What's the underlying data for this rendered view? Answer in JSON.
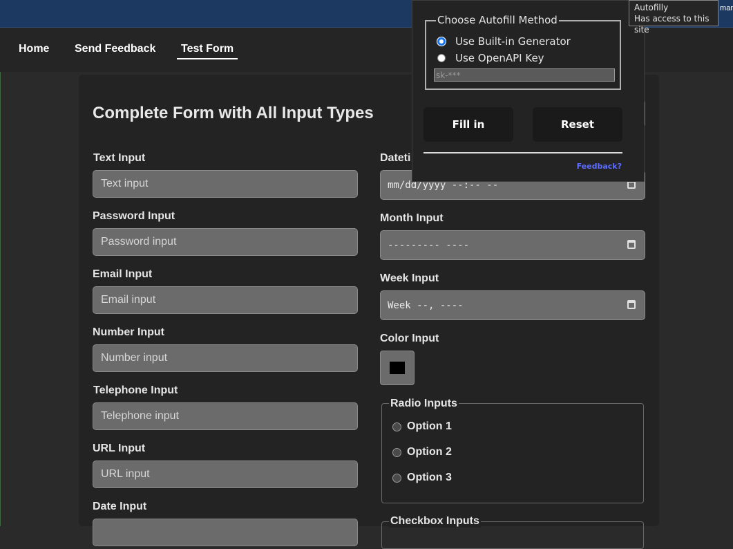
{
  "topbar": {
    "clipped_text": "mar"
  },
  "nav": {
    "items": [
      {
        "label": "Home"
      },
      {
        "label": "Send Feedback"
      },
      {
        "label": "Test Form"
      }
    ]
  },
  "form": {
    "title": "Complete Form with All Input Types",
    "left_fields": [
      {
        "label": "Text Input",
        "placeholder": "Text input"
      },
      {
        "label": "Password Input",
        "placeholder": "Password input"
      },
      {
        "label": "Email Input",
        "placeholder": "Email input"
      },
      {
        "label": "Number Input",
        "placeholder": "Number input"
      },
      {
        "label": "Telephone Input",
        "placeholder": "Telephone input"
      },
      {
        "label": "URL Input",
        "placeholder": "URL input"
      },
      {
        "label": "Date Input"
      }
    ],
    "right_fields": [
      {
        "label": "Dateti",
        "value": "mm/dd/yyyy --:-- --"
      },
      {
        "label": "Month Input",
        "value": "--------- ----"
      },
      {
        "label": "Week Input",
        "value": "Week --, ----"
      },
      {
        "label": "Color Input",
        "value": "#000000"
      }
    ],
    "radio_group": {
      "legend": "Radio Inputs",
      "options": [
        "Option 1",
        "Option 2",
        "Option 3"
      ]
    },
    "checkbox_group": {
      "legend": "Checkbox Inputs"
    }
  },
  "popup": {
    "legend": "Choose Autofill Method",
    "options": [
      {
        "label": "Use Built-in Generator",
        "selected": true
      },
      {
        "label": "Use OpenAPI Key",
        "selected": false
      }
    ],
    "api_key_placeholder": "sk-***",
    "fill_button": "Fill in",
    "reset_button": "Reset",
    "feedback_link": "Feedback?"
  },
  "tooltip": {
    "title": "Autofilly",
    "subtitle": "Has access to this site"
  },
  "colors": {
    "accent": "#1a73e8",
    "topbar": "#1c3a61",
    "link": "#5b6cff"
  }
}
